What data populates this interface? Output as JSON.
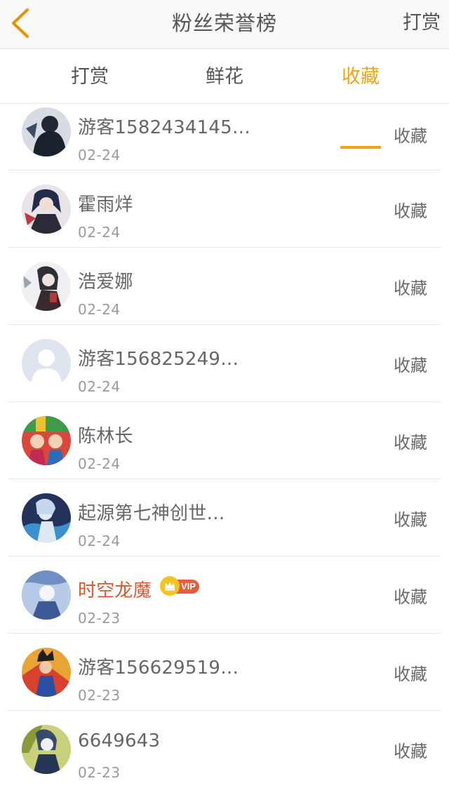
{
  "header": {
    "title": "粉丝荣誉榜",
    "right_action": "打赏",
    "back_icon": "chevron-left-icon",
    "accent_color": "#f2a30f"
  },
  "tabs": [
    {
      "label": "打赏",
      "active": false
    },
    {
      "label": "鲜花",
      "active": false
    },
    {
      "label": "收藏",
      "active": true
    }
  ],
  "list": [
    {
      "name": "游客1582434145…",
      "date": "02-24",
      "action": "收藏"
    },
    {
      "name": "霍雨烊",
      "date": "02-24",
      "action": "收藏"
    },
    {
      "name": "浩爱娜",
      "date": "02-24",
      "action": "收藏"
    },
    {
      "name": "游客156825249…",
      "date": "02-24",
      "action": "收藏"
    },
    {
      "name": "陈林长",
      "date": "02-24",
      "action": "收藏"
    },
    {
      "name": "起源第七神创世…",
      "date": "02-24",
      "action": "收藏"
    },
    {
      "name": "时空龙魔",
      "date": "02-23",
      "action": "收藏",
      "vip": true,
      "vip_label": "VIP",
      "name_color": "#e2532e"
    },
    {
      "name": "游客156629519…",
      "date": "02-23",
      "action": "收藏"
    },
    {
      "name": "6649643",
      "date": "02-23",
      "action": "收藏"
    }
  ]
}
